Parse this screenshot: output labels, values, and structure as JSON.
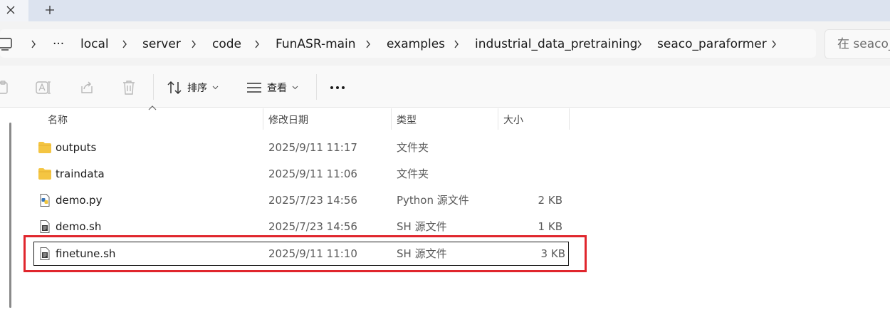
{
  "tabbar": {
    "close_glyph": "✕",
    "new_tab_glyph": "+"
  },
  "address": {
    "overflow_label": "···",
    "crumbs": [
      "local",
      "server",
      "code",
      "FunASR-main",
      "examples",
      "industrial_data_pretraining",
      "seaco_paraformer"
    ],
    "search_placeholder": "在 seaco_"
  },
  "toolbar": {
    "sort_label": "排序",
    "view_label": "查看",
    "more_label": "···"
  },
  "columns": {
    "name": "名称",
    "date": "修改日期",
    "type": "类型",
    "size": "大小"
  },
  "files": [
    {
      "name": "outputs",
      "date": "2025/9/11 11:17",
      "type": "文件夹",
      "size": "",
      "icon": "folder-icon"
    },
    {
      "name": "traindata",
      "date": "2025/9/11 11:06",
      "type": "文件夹",
      "size": "",
      "icon": "folder-icon"
    },
    {
      "name": "demo.py",
      "date": "2025/7/23 14:56",
      "type": "Python 源文件",
      "size": "2 KB",
      "icon": "python-file-icon"
    },
    {
      "name": "demo.sh",
      "date": "2025/7/23 14:56",
      "type": "SH 源文件",
      "size": "1 KB",
      "icon": "shell-file-icon"
    },
    {
      "name": "finetune.sh",
      "date": "2025/9/11 11:10",
      "type": "SH 源文件",
      "size": "3 KB",
      "icon": "shell-file-icon"
    }
  ],
  "colors": {
    "highlight": "#e0262d",
    "folder": "#f4c542",
    "selection_border": "#1b1b1b"
  }
}
